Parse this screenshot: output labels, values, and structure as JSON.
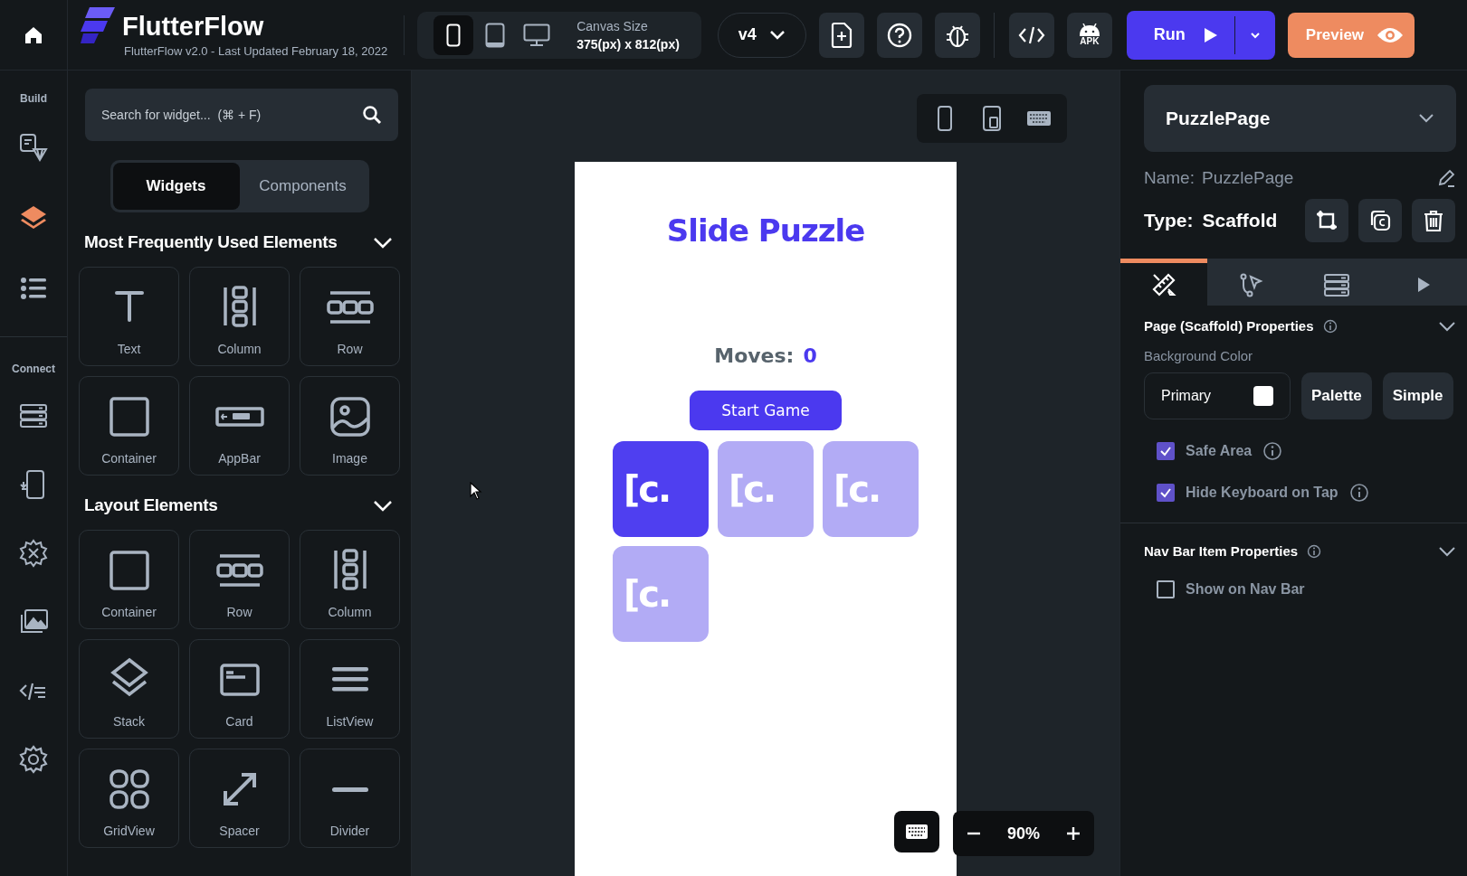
{
  "topbar": {
    "app_name": "FlutterFlow",
    "subtitle": "FlutterFlow v2.0 - Last Updated February 18, 2022",
    "devices": [
      {
        "kind": "phone",
        "selected": true
      },
      {
        "kind": "tablet",
        "selected": false
      },
      {
        "kind": "desktop",
        "selected": false
      }
    ],
    "canvas_size_label": "Canvas Size",
    "canvas_size": "375(px) x 812(px)",
    "version": "v4",
    "tools": [
      {
        "kind": "add-page"
      },
      {
        "kind": "help"
      },
      {
        "kind": "bug"
      }
    ],
    "export_tools": [
      {
        "kind": "code"
      },
      {
        "kind": "apk",
        "label": "APK"
      }
    ],
    "run": "Run",
    "preview": "Preview"
  },
  "rail": [
    {
      "label": "Build",
      "items": [
        {
          "kind": "theme",
          "selected": false
        },
        {
          "kind": "layers",
          "selected": true
        },
        {
          "kind": "list",
          "selected": false
        }
      ]
    },
    {
      "label": "Connect",
      "items": [
        {
          "kind": "database",
          "selected": false
        },
        {
          "kind": "phone-download",
          "selected": false
        },
        {
          "kind": "gear-sparkle",
          "selected": false
        },
        {
          "kind": "images",
          "selected": false
        },
        {
          "kind": "code",
          "selected": false
        },
        {
          "kind": "settings",
          "selected": false
        }
      ]
    }
  ],
  "widget_panel": {
    "search": {
      "placeholder": "Search for widget...  (⌘ + F)"
    },
    "tabs": [
      {
        "label": "Widgets",
        "selected": true
      },
      {
        "label": "Components",
        "selected": false
      }
    ],
    "groups": [
      {
        "title": "Most Frequently Used Elements",
        "expanded": true,
        "items": [
          {
            "label": "Text",
            "kind": "text"
          },
          {
            "label": "Column",
            "kind": "column"
          },
          {
            "label": "Row",
            "kind": "row"
          },
          {
            "label": "Container",
            "kind": "container"
          },
          {
            "label": "AppBar",
            "kind": "appbar"
          },
          {
            "label": "Image",
            "kind": "image"
          }
        ]
      },
      {
        "title": "Layout Elements",
        "expanded": true,
        "items": [
          {
            "label": "Container",
            "kind": "container"
          },
          {
            "label": "Row",
            "kind": "row"
          },
          {
            "label": "Column",
            "kind": "column"
          },
          {
            "label": "Stack",
            "kind": "stack"
          },
          {
            "label": "Card",
            "kind": "card"
          },
          {
            "label": "ListView",
            "kind": "listview"
          },
          {
            "label": "GridView",
            "kind": "gridview"
          },
          {
            "label": "Spacer",
            "kind": "spacer"
          },
          {
            "label": "Divider",
            "kind": "divider"
          }
        ]
      }
    ]
  },
  "canvas": {
    "device_modes": [
      {
        "kind": "phone"
      },
      {
        "kind": "tablet-phone"
      },
      {
        "kind": "keyboard"
      }
    ],
    "phone": {
      "title": "Slide Puzzle",
      "moves_label": "Moves:",
      "moves_value": "0",
      "button": "Start Game",
      "tiles": [
        {
          "label": "[c.",
          "selected": true
        },
        {
          "label": "[c.",
          "selected": false
        },
        {
          "label": "[c.",
          "selected": false
        },
        {
          "label": "[c.",
          "selected": false
        }
      ]
    },
    "zoom": "90%"
  },
  "properties": {
    "page": "PuzzlePage",
    "name_label": "Name:",
    "name_value": "PuzzlePage",
    "type_label": "Type:",
    "type_value": "Scaffold",
    "actions": [
      {
        "kind": "crop"
      },
      {
        "kind": "copy"
      },
      {
        "kind": "delete"
      }
    ],
    "tabs": [
      {
        "kind": "design",
        "selected": true
      },
      {
        "kind": "actions",
        "selected": false
      },
      {
        "kind": "backend",
        "selected": false
      },
      {
        "kind": "play",
        "selected": false
      }
    ],
    "sections": [
      {
        "title": "Page (Scaffold) Properties",
        "expanded": true,
        "color_label": "Background Color",
        "color_value": "Primary",
        "color_buttons": [
          "Palette",
          "Simple"
        ],
        "options": [
          {
            "label": "Safe Area",
            "checked": true,
            "info": true
          },
          {
            "label": "Hide Keyboard on Tap",
            "checked": true,
            "info": true
          }
        ]
      },
      {
        "title": "Nav Bar Item Properties",
        "expanded": true,
        "options": [
          {
            "label": "Show on Nav Bar",
            "checked": false,
            "info": false
          }
        ]
      }
    ]
  }
}
